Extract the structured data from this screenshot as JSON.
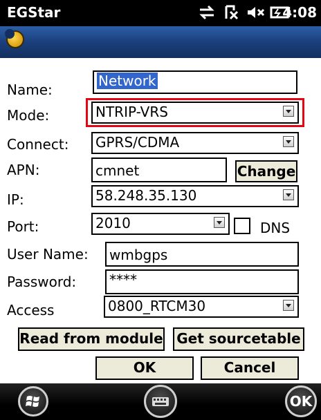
{
  "status": {
    "app_title": "EGStar",
    "time": "4:08"
  },
  "form": {
    "name": {
      "label": "Name:",
      "value": "Network"
    },
    "mode": {
      "label": "Mode:",
      "value": "NTRIP-VRS"
    },
    "connect": {
      "label": "Connect:",
      "value": "GPRS/CDMA"
    },
    "apn": {
      "label": "APN:",
      "value": "cmnet",
      "button": "Change"
    },
    "ip": {
      "label": "IP:",
      "value": "58.248.35.130"
    },
    "port": {
      "label": "Port:",
      "value": "2010",
      "dns_label": "DNS"
    },
    "user_name": {
      "label": "User Name:",
      "value": "wmbgps"
    },
    "password": {
      "label": "Password:",
      "value": "****"
    },
    "access": {
      "label": "Access",
      "value": "0800_RTCM30"
    }
  },
  "buttons": {
    "read_from_module": "Read from module",
    "get_sourcetable": "Get sourcetable",
    "ok": "OK",
    "cancel": "Cancel"
  },
  "softkeys": {
    "ok": "OK"
  },
  "colors": {
    "highlight": "#e30613",
    "selection": "#3366cc",
    "button_bg": "#ecebd9",
    "appbar": "#1b3f7c"
  }
}
